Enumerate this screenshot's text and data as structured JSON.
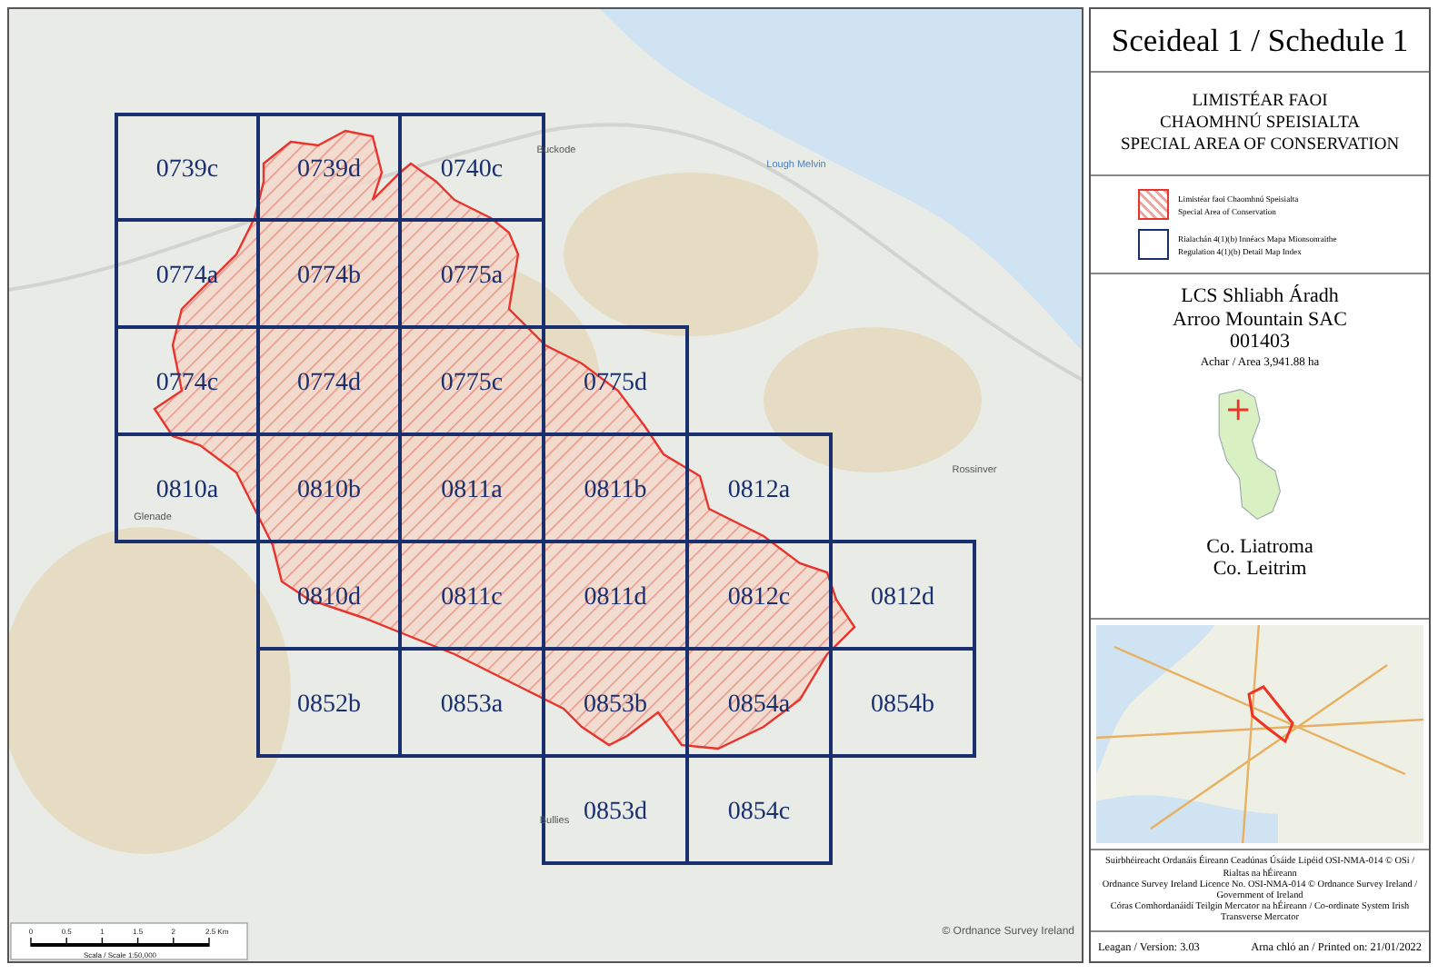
{
  "map": {
    "grid_rows": [
      [
        "0739c",
        "0739d",
        "0740c"
      ],
      [
        "0774a",
        "0774b",
        "0775a"
      ],
      [
        "0774c",
        "0774d",
        "0775c",
        "0775d"
      ],
      [
        "0810a",
        "0810b",
        "0811a",
        "0811b",
        "0812a"
      ],
      [
        "0810d",
        "0811c",
        "0811d",
        "0812c",
        "0812d"
      ],
      [
        "0852b",
        "0853a",
        "0853b",
        "0854a",
        "0854b"
      ],
      [
        "0853d",
        "0854c"
      ]
    ],
    "place_names": [
      "Lough Melvin",
      "Buckode",
      "Glenade",
      "Rossinver",
      "Bullies"
    ],
    "copyright": "© Ordnance Survey Ireland",
    "scale_bar": {
      "ticks": [
        "0",
        "0.5",
        "1",
        "1.5",
        "2",
        "2.5 Km"
      ],
      "caption": "Scala / Scale 1:50,000"
    }
  },
  "panel": {
    "title": "Sceideal 1 / Schedule 1",
    "subtitle_lines": [
      "LIMISTÉAR FAOI",
      "CHAOMHNÚ SPEISIALTA",
      "SPECIAL AREA OF CONSERVATION"
    ],
    "legend": [
      {
        "kind": "sac",
        "lines": [
          "Limistéar faoi Chaomhnú Speisialta",
          "Special Area of Conservation"
        ]
      },
      {
        "kind": "grid",
        "lines": [
          "Rialachán 4(1)(b) Innéacs Mapa Mionsonraithe",
          "Regulation 4(1)(b) Detail Map Index"
        ]
      }
    ],
    "site_lines": [
      "LCS Shliabh Áradh",
      "Arroo Mountain SAC"
    ],
    "site_code": "001403",
    "area": "Achar / Area 3,941.88 ha",
    "county_lines": [
      "Co. Liatroma",
      "Co. Leitrim"
    ],
    "notes": [
      "Suirbhéireacht Ordanáis Éireann Ceadúnas Úsáide Lipéid OSI-NMA-014 © OSi / Rialtas na hÉireann",
      "Ordnance Survey Ireland Licence No. OSI-NMA-014 © Ordnance Survey Ireland / Government of Ireland",
      "Córas Comhordanáidí Teilgin Mercator na hÉireann / Co-ordinate System Irish Transverse Mercator"
    ],
    "version": "Leagan / Version: 3.03",
    "printed": "Arna chló an / Printed on: 21/01/2022"
  }
}
